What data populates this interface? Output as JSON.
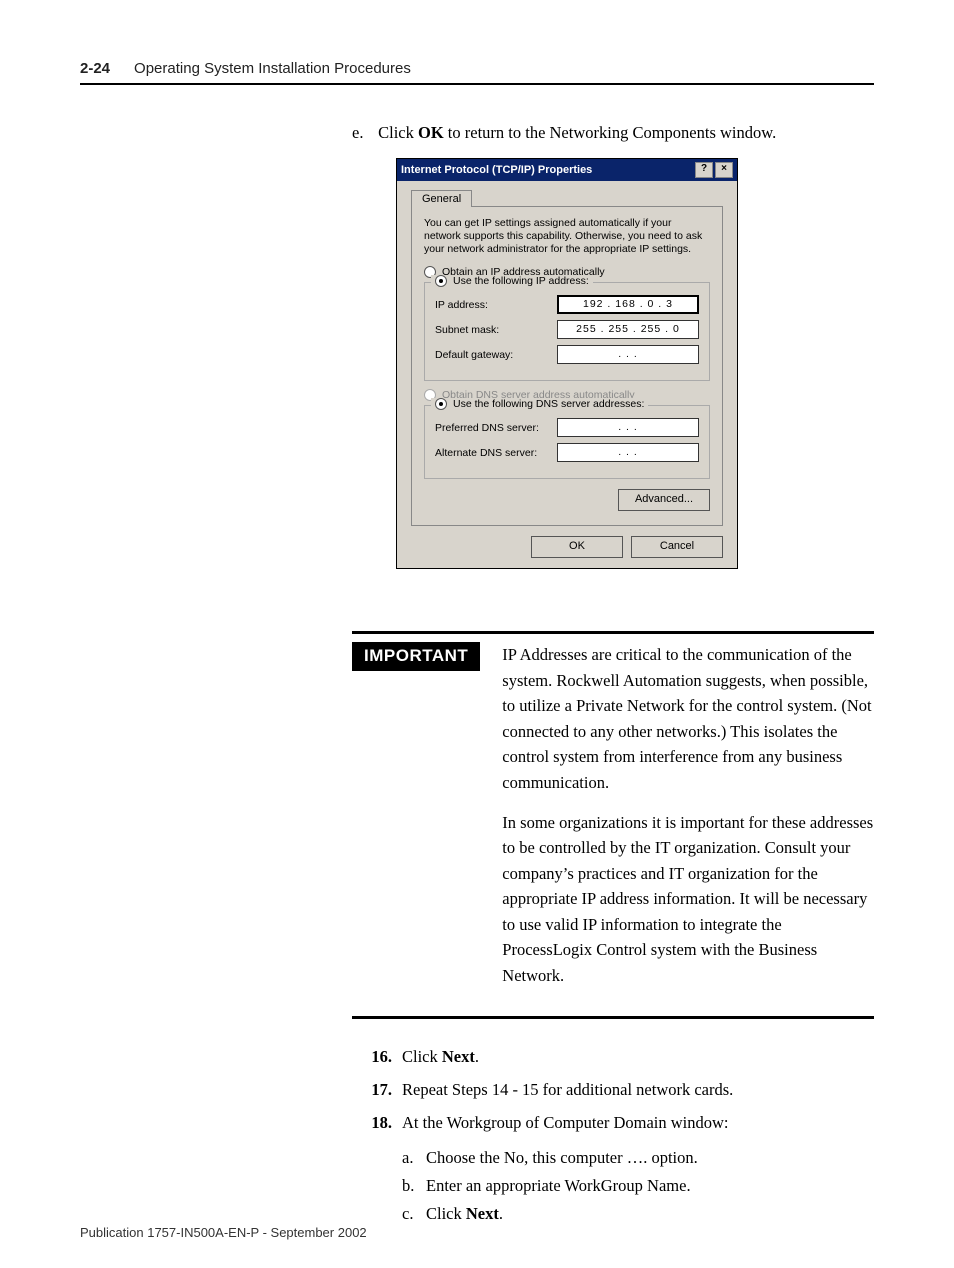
{
  "header": {
    "page_num": "2-24",
    "section": "Operating System Installation Procedures"
  },
  "step_e": {
    "letter": "e.",
    "pre": "Click ",
    "bold": "OK",
    "post": " to return to the Networking Components window."
  },
  "dialog": {
    "title": "Internet Protocol (TCP/IP) Properties",
    "help": "?",
    "close": "×",
    "tab": "General",
    "blurb": "You can get IP settings assigned automatically if your network supports this capability. Otherwise, you need to ask your network administrator for the appropriate IP settings.",
    "radio_obtain_ip": "Obtain an IP address automatically",
    "radio_use_ip": "Use the following IP address:",
    "lbl_ip": "IP address:",
    "val_ip": "192 . 168 .  0  .  3",
    "lbl_mask": "Subnet mask:",
    "val_mask": "255 . 255 . 255 .  0",
    "lbl_gw": "Default gateway:",
    "val_gw": ".       .       .",
    "radio_obtain_dns": "Obtain DNS server address automatically",
    "radio_use_dns": "Use the following DNS server addresses:",
    "lbl_pref_dns": "Preferred DNS server:",
    "val_pref_dns": ".       .       .",
    "lbl_alt_dns": "Alternate DNS server:",
    "val_alt_dns": ".       .       .",
    "btn_adv": "Advanced...",
    "btn_ok": "OK",
    "btn_cancel": "Cancel"
  },
  "important": {
    "tag": "IMPORTANT",
    "p1": "IP Addresses are critical to the communication of the system. Rockwell Automation suggests, when possible, to utilize a Private Network for the control system. (Not connected to any other networks.) This isolates the control system from interference from any business communication.",
    "p2": "In some organizations it is important for these addresses to be controlled by the IT organization. Consult your company’s practices and IT organization for the appropriate IP address information. It will be necessary to use valid IP information to integrate the ProcessLogix Control system with the Business Network."
  },
  "steps": {
    "s16": {
      "num": "16.",
      "pre": "Click ",
      "bold": "Next",
      "post": "."
    },
    "s17": {
      "num": "17.",
      "text": "Repeat Steps 14 - 15 for additional network cards."
    },
    "s18": {
      "num": "18.",
      "text": "At the Workgroup of Computer Domain window:",
      "a": {
        "l": "a.",
        "t": "Choose the No, this computer …. option."
      },
      "b": {
        "l": "b.",
        "t": "Enter an appropriate WorkGroup Name."
      },
      "c": {
        "l": "c.",
        "pre": "Click ",
        "bold": "Next",
        "post": "."
      }
    }
  },
  "footer": "Publication 1757-IN500A-EN-P - September 2002"
}
